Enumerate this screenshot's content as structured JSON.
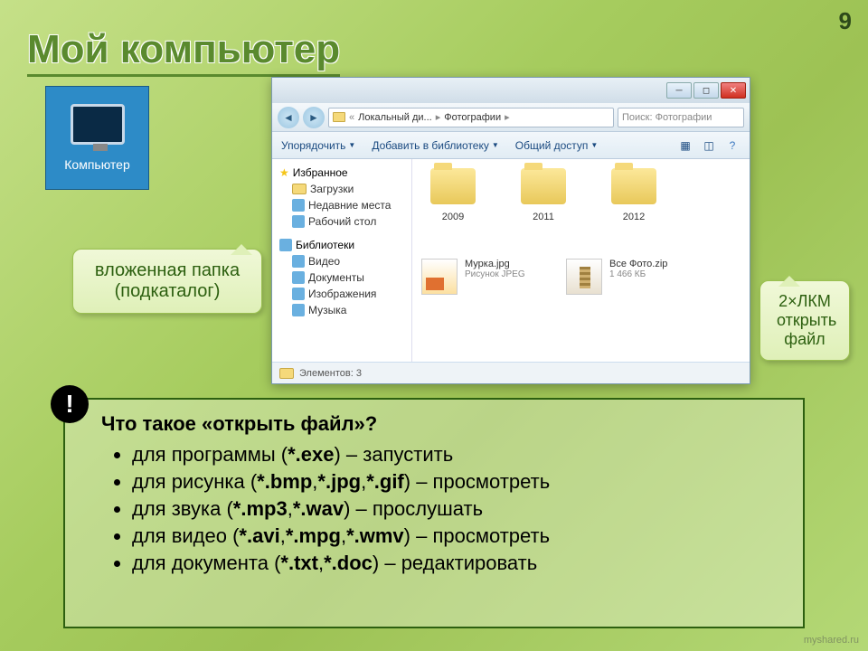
{
  "page_number": "9",
  "slide_title": "Мой компьютер",
  "computer_label": "Компьютер",
  "explorer": {
    "breadcrumb": {
      "part1": "Локальный ди...",
      "part2": "Фотографии"
    },
    "search_placeholder": "Поиск: Фотографии",
    "toolbar": {
      "organize": "Упорядочить",
      "addlib": "Добавить в библиотеку",
      "share": "Общий доступ"
    },
    "sidebar": {
      "favorites": "Избранное",
      "downloads": "Загрузки",
      "recent": "Недавние места",
      "desktop": "Рабочий стол",
      "libraries": "Библиотеки",
      "video": "Видео",
      "documents": "Документы",
      "pictures": "Изображения",
      "music": "Музыка"
    },
    "folders": {
      "f1": "2009",
      "f2": "2011",
      "f3": "2012"
    },
    "file_img": {
      "name": "Мурка.jpg",
      "sub": "Рисунок JPEG"
    },
    "file_zip": {
      "name": "Все Фото.zip",
      "sub": "1 466 КБ"
    },
    "status": "Элементов: 3"
  },
  "callout1": {
    "line1": "вложенная папка",
    "line2": "(подкаталог)"
  },
  "callout2": {
    "line1": "2×ЛКМ",
    "line2": "открыть",
    "line3": "файл"
  },
  "info": {
    "bang": "!",
    "question": "Что такое «открыть файл»?",
    "bullets": {
      "b1a": "для программы (",
      "b1b": "*.exe",
      "b1c": ") – запустить",
      "b2a": "для рисунка (",
      "b2b": "*.bmp",
      "b2c": ",",
      "b2d": "*.jpg",
      "b2e": ",",
      "b2f": "*.gif",
      "b2g": ") – просмотреть",
      "b3a": "для звука (",
      "b3b": "*.mp3",
      "b3c": ",",
      "b3d": "*.wav",
      "b3e": ") – прослушать",
      "b4a": "для видео (",
      "b4b": "*.avi",
      "b4c": ",",
      "b4d": "*.mpg",
      "b4e": ",",
      "b4f": "*.wmv",
      "b4g": ") – просмотреть",
      "b5a": "для документа (",
      "b5b": "*.txt",
      "b5c": ",",
      "b5d": "*.doc",
      "b5e": ") – редактировать"
    }
  },
  "watermark": "myshared.ru"
}
